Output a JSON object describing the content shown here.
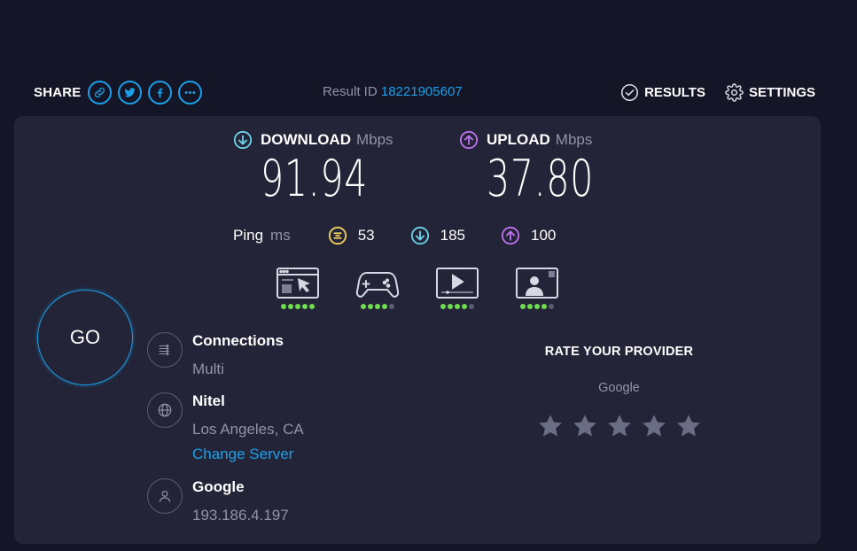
{
  "share": {
    "label": "SHARE",
    "buttons": [
      "link-icon",
      "twitter-icon",
      "facebook-icon",
      "more-icon"
    ]
  },
  "result": {
    "label": "Result ID",
    "id": "18221905607"
  },
  "nav": {
    "results": "RESULTS",
    "settings": "SETTINGS"
  },
  "download": {
    "label": "DOWNLOAD",
    "unit": "Mbps",
    "value": "91.94"
  },
  "upload": {
    "label": "UPLOAD",
    "unit": "Mbps",
    "value": "37.80"
  },
  "ping": {
    "label": "Ping",
    "unit": "ms",
    "idle": "53",
    "download": "185",
    "upload": "100"
  },
  "use_cases": [
    {
      "icon": "web-browsing-icon",
      "rating": 5,
      "max": 5
    },
    {
      "icon": "gaming-icon",
      "rating": 4,
      "max": 5
    },
    {
      "icon": "video-streaming-icon",
      "rating": 4,
      "max": 5
    },
    {
      "icon": "video-chat-icon",
      "rating": 4,
      "max": 5
    }
  ],
  "go": "GO",
  "connections": {
    "title": "Connections",
    "value": "Multi"
  },
  "server": {
    "name": "Nitel",
    "location": "Los Angeles, CA",
    "change": "Change Server"
  },
  "isp": {
    "name": "Google",
    "ip": "193.186.4.197"
  },
  "rate": {
    "title": "RATE YOUR PROVIDER",
    "provider": "Google",
    "stars": 5
  },
  "colors": {
    "background": "#141526",
    "panel": "#232438",
    "accent": "#1aa0e8",
    "download": "#6ad3e8",
    "upload": "#bf71f0",
    "ping": "#f2d15c",
    "muted": "#9193a8",
    "dot_on": "#6fdc4e",
    "dot_off": "#5b5c72"
  }
}
